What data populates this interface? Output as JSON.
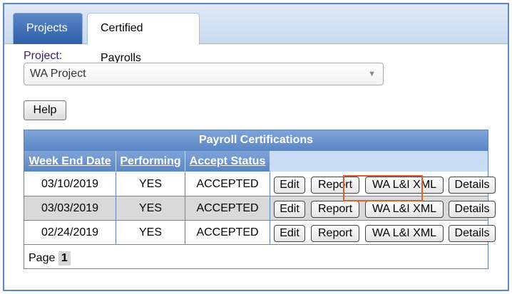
{
  "tabs": [
    {
      "label": "Projects",
      "active": false
    },
    {
      "label": "Certified Payrolls",
      "active": true
    }
  ],
  "project": {
    "label": "Project:",
    "selected": "WA Project"
  },
  "help_label": "Help",
  "grid": {
    "title": "Payroll Certifications",
    "columns": [
      "Week End Date",
      "Performing",
      "Accept Status"
    ],
    "rows": [
      {
        "date": "03/10/2019",
        "performing": "YES",
        "status": "ACCEPTED"
      },
      {
        "date": "03/03/2019",
        "performing": "YES",
        "status": "ACCEPTED"
      },
      {
        "date": "02/24/2019",
        "performing": "YES",
        "status": "ACCEPTED"
      }
    ],
    "actions": {
      "edit": "Edit",
      "report": "Report",
      "xml": "WA L&I XML",
      "details": "Details"
    },
    "pager": {
      "label": "Page",
      "current": "1"
    }
  },
  "colors": {
    "highlight": "#d9622b",
    "header_blue": "#5b87c6"
  }
}
